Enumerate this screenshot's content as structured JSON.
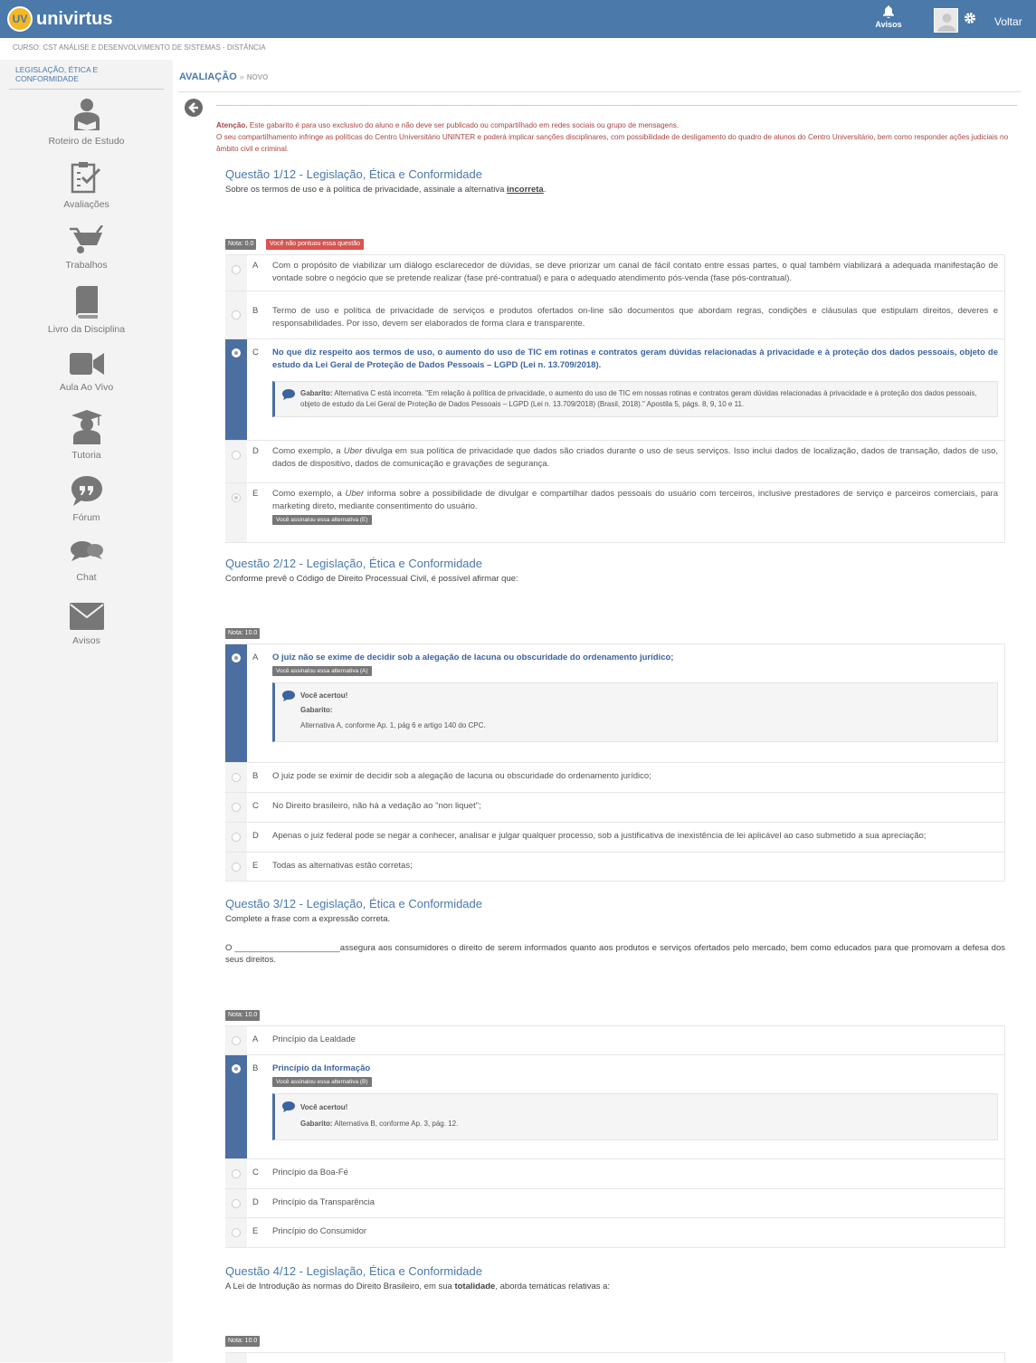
{
  "brand": {
    "logo_initials": "UV",
    "name": "univirtus"
  },
  "topbar": {
    "avisos": "Avisos",
    "voltar": "Voltar"
  },
  "breadcrumb": "CURSO: CST ANÁLISE E DESENVOLVIMENTO DE SISTEMAS - DISTÂNCIA",
  "sidebar": {
    "course": "LEGISLAÇÃO, ÉTICA E CONFORMIDADE",
    "items": [
      {
        "label": "Roteiro de Estudo",
        "icon": "user-book-icon"
      },
      {
        "label": "Avaliações",
        "icon": "clipboard-check-icon"
      },
      {
        "label": "Trabalhos",
        "icon": "wheelbarrow-icon"
      },
      {
        "label": "Livro da Disciplina",
        "icon": "book-icon"
      },
      {
        "label": "Aula Ao Vivo",
        "icon": "video-camera-icon"
      },
      {
        "label": "Tutoria",
        "icon": "graduate-icon"
      },
      {
        "label": "Fórum",
        "icon": "quote-bubble-icon"
      },
      {
        "label": "Chat",
        "icon": "chat-bubbles-icon"
      },
      {
        "label": "Avisos",
        "icon": "envelope-icon"
      }
    ]
  },
  "page": {
    "title": "AVALIAÇÃO",
    "sep": "»",
    "status": "NOVO"
  },
  "warning": {
    "bold": "Atenção.",
    "line1": " Este gabarito é para uso exclusivo do aluno e não deve ser publicado ou compartilhado em redes sociais ou grupo de mensagens.",
    "line2": "O seu compartilhamento infringe as políticas do Centro Universitário UNINTER e poderá implicar sanções disciplinares, com possibilidade de desligamento do quadro de alunos do Centro Universitário, bem como responder ações judiciais no âmbito civil e criminal."
  },
  "questions": [
    {
      "title": "Questão 1/12 - Legislação, Ética e Conformidade",
      "text_before": "Sobre os termos de uso e à política de privacidade, assinale a alternativa ",
      "text_bold": "incorreta",
      "text_after": ".",
      "nota": "Nota: 0.0",
      "nao_pontuou": "Você não pontuou essa questão",
      "options": [
        {
          "letter": "A",
          "text": "Com o propósito de viabilizar um diálogo esclarecedor de dúvidas, se deve priorizar um canal de fácil contato entre essas partes, o qual também viabilizará a adequada manifestação de vontade sobre o negócio que se pretende realizar (fase pré-contratual) e para o adequado atendimento pós-venda (fase pós-contratual)."
        },
        {
          "letter": "B",
          "text": "Termo de uso e política de privacidade de serviços e produtos ofertados on-line são documentos que abordam regras, condições e cláusulas que estipulam direitos, deveres e responsabilidades. Por isso, devem ser elaborados de forma clara e transparente."
        },
        {
          "letter": "C",
          "text": "No que diz respeito aos termos de uso, o aumento do uso de TIC em rotinas e contratos geram dúvidas relacionadas à privacidade e à proteção dos dados pessoais, objeto de estudo da Lei Geral de Proteção de Dados Pessoais – LGPD (Lei n. 13.709/2018).",
          "feedback_bold": "Gabarito:",
          "feedback": " Alternativa C está incorreta. \"Em relação à política de privacidade, o aumento do uso de TIC em nossas rotinas e contratos geram dúvidas relacionadas à privacidade e à proteção dos dados pessoais, objeto de estudo da Lei Geral de Proteção de Dados Pessoais – LGPD (Lei n. 13.709/2018) (Brasil, 2018).\" Apostila 5, págs. 8, 9, 10 e 11."
        },
        {
          "letter": "D",
          "text_before": "Como exemplo, a ",
          "text_italic": "Uber",
          "text_after": " divulga em sua política de privacidade que dados são criados durante o uso de seus serviços. Isso inclui dados de localização, dados de transação, dados de uso, dados de dispositivo, dados de comunicação e gravações de segurança."
        },
        {
          "letter": "E",
          "text_before": "Como exemplo, a ",
          "text_italic": "Uber",
          "text_after": " informa sobre a possibilidade de divulgar e compartilhar dados pessoais do usuário com terceiros, inclusive prestadores de serviço e parceiros comerciais, para marketing direto, mediante consentimento do usuário.",
          "tag": "Você assinalou essa alternativa (E)"
        }
      ]
    },
    {
      "title": "Questão 2/12 - Legislação, Ética e Conformidade",
      "text": "Conforme prevê o Código de Direito Processual Civil, é possível afirmar que:",
      "nota": "Nota: 10.0",
      "options": [
        {
          "letter": "A",
          "text": "O juiz não se exime de decidir sob a alegação de lacuna ou obscuridade do ordenamento jurídico;",
          "tag": "Você assinalou essa alternativa (A)",
          "fb_title": "Você acertou!",
          "fb_gabarito": "Gabarito:",
          "fb_text": "Alternativa A, conforme Ap. 1, pág 6 e artigo 140 do CPC."
        },
        {
          "letter": "B",
          "text": "O juiz pode se eximir de decidir sob a alegação de lacuna ou obscuridade do ordenamento jurídico;"
        },
        {
          "letter": "C",
          "text": "No Direito brasileiro, não há a vedação ao \"non liquet\";"
        },
        {
          "letter": "D",
          "text": "Apenas o juiz federal pode se negar a conhecer, analisar e julgar qualquer processo, sob a justificativa de inexistência de lei aplicável ao caso submetido a sua apreciação;"
        },
        {
          "letter": "E",
          "text": "Todas as alternativas estão corretas;"
        }
      ]
    },
    {
      "title": "Questão 3/12 - Legislação, Ética e Conformidade",
      "text": "Complete a frase com a expressão correta.",
      "text2": "O ______________________assegura aos consumidores o direito de serem informados quanto aos produtos e serviços ofertados pelo mercado, bem como educados para que promovam a defesa dos seus direitos.",
      "nota": "Nota: 10.0",
      "options": [
        {
          "letter": "A",
          "text": "Princípio da Lealdade"
        },
        {
          "letter": "B",
          "text": "Princípio da Informação",
          "tag": "Você assinalou essa alternativa (B)",
          "fb_title": "Você acertou!",
          "fb_gabarito": "Gabarito:",
          "fb_text": " Alternativa B, conforme Ap. 3, pág. 12."
        },
        {
          "letter": "C",
          "text": "Princípio da Boa-Fé"
        },
        {
          "letter": "D",
          "text": "Princípio da Transparência"
        },
        {
          "letter": "E",
          "text": "Princípio do Consumidor"
        }
      ]
    },
    {
      "title": "Questão 4/12 - Legislação, Ética e Conformidade",
      "text_before": "A Lei de Introdução às normas do Direito Brasileiro, em sua ",
      "text_bold": "totalidade",
      "text_after": ", aborda temáticas relativas a:",
      "nota": "Nota: 10.0"
    }
  ]
}
